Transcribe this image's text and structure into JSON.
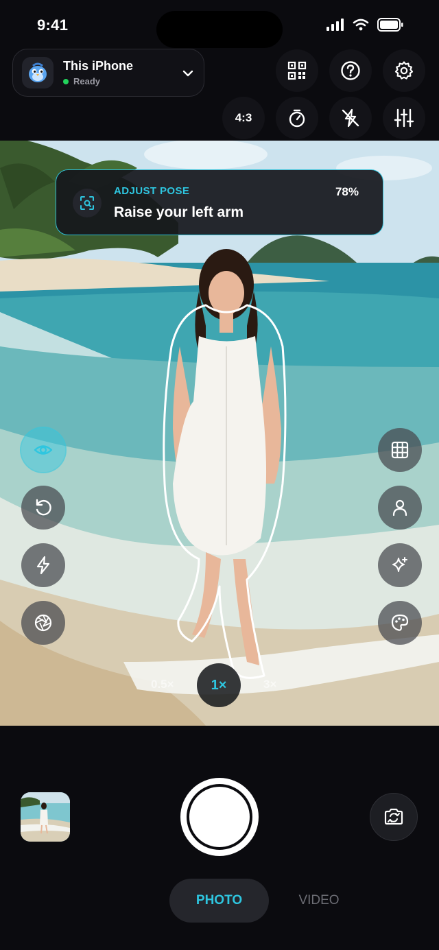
{
  "status_bar": {
    "time": "9:41"
  },
  "device": {
    "name": "This iPhone",
    "status": "Ready"
  },
  "top_controls": {
    "aspect_ratio": "4:3"
  },
  "pose_guide": {
    "label": "ADJUST POSE",
    "instruction": "Raise your left arm",
    "confidence": "78%"
  },
  "zoom": {
    "options": [
      "0.5×",
      "1×",
      "3×"
    ],
    "selected": "1×"
  },
  "modes": {
    "photo": "PHOTO",
    "video": "VIDEO",
    "selected": "PHOTO"
  },
  "colors": {
    "accent": "#2ec6e0",
    "ready": "#22d35c",
    "background": "#0b0b0f"
  },
  "icons": {
    "top": [
      "qr-code-icon",
      "help-icon",
      "settings-icon",
      "timer-icon",
      "flash-off-icon",
      "adjust-sliders-icon"
    ],
    "left": [
      "eye-icon",
      "undo-icon",
      "flash-icon",
      "aperture-icon"
    ],
    "right": [
      "grid-icon",
      "person-icon",
      "sparkles-icon",
      "palette-icon"
    ],
    "bottom": [
      "gallery-thumbnail",
      "shutter",
      "flip-camera-icon"
    ]
  }
}
